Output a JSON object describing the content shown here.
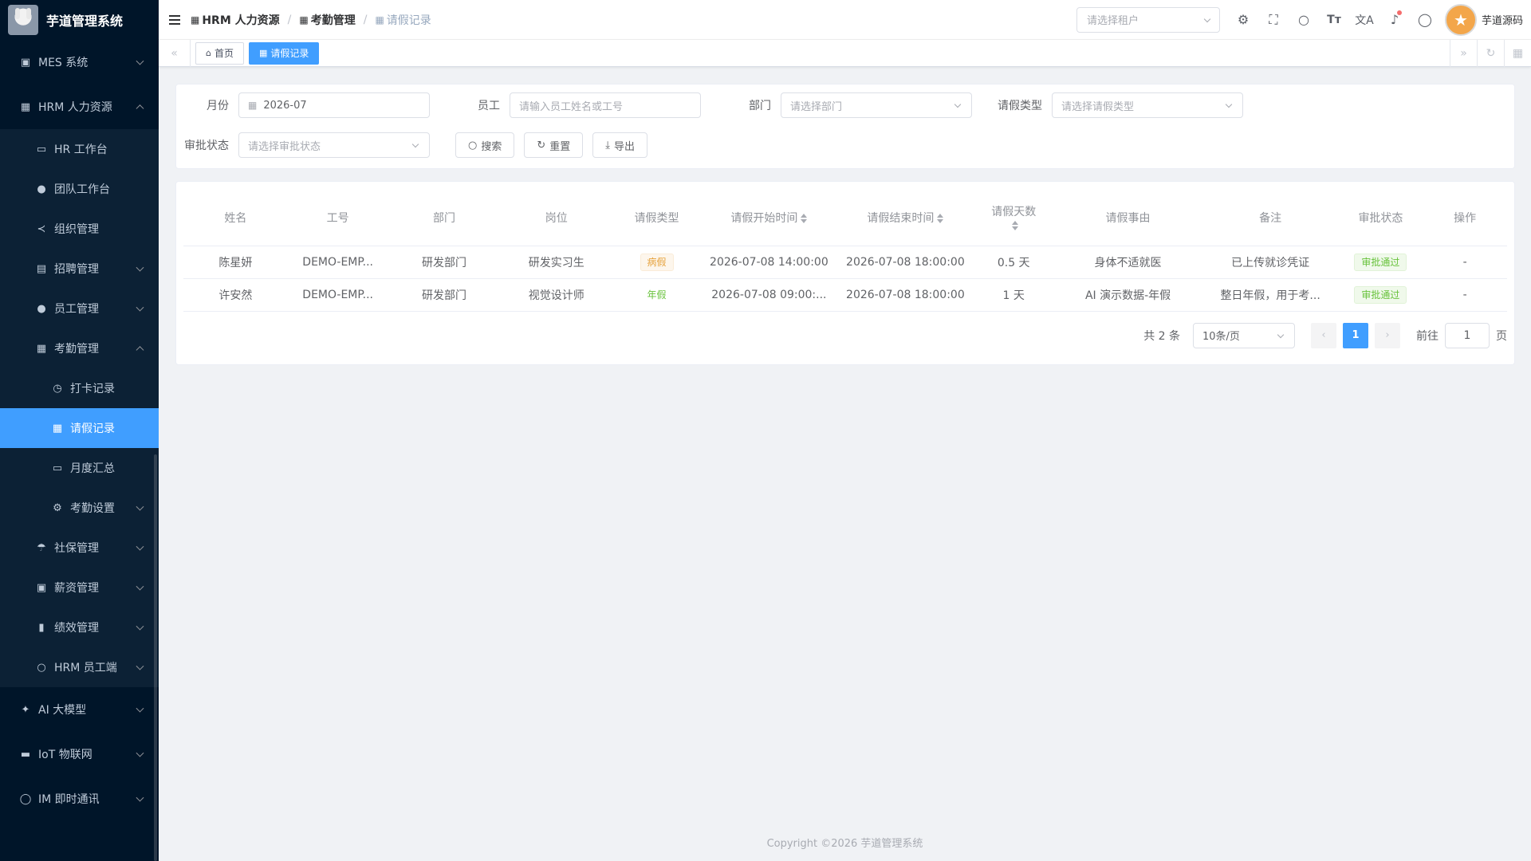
{
  "app": {
    "title": "芋道管理系统"
  },
  "sidebar": {
    "items": [
      {
        "label": "MES 系统",
        "icon": "cpu-icon"
      },
      {
        "label": "HRM 人力资源",
        "icon": "office-building-icon"
      }
    ],
    "hrm_sub": [
      {
        "label": "HR 工作台",
        "icon": "monitor-icon"
      },
      {
        "label": "团队工作台",
        "icon": "user-icon"
      },
      {
        "label": "组织管理",
        "icon": "share-icon"
      },
      {
        "label": "招聘管理",
        "icon": "briefcase-icon"
      },
      {
        "label": "员工管理",
        "icon": "user-icon"
      },
      {
        "label": "考勤管理",
        "icon": "calendar-icon"
      }
    ],
    "attendance_sub": [
      {
        "label": "打卡记录",
        "icon": "stopwatch-icon"
      },
      {
        "label": "请假记录",
        "icon": "calendar-icon"
      },
      {
        "label": "月度汇总",
        "icon": "monitor-icon"
      },
      {
        "label": "考勤设置",
        "icon": "gear-icon"
      }
    ],
    "hrm_sub2": [
      {
        "label": "社保管理",
        "icon": "umbrella-icon"
      },
      {
        "label": "薪资管理",
        "icon": "wallet-icon"
      },
      {
        "label": "绩效管理",
        "icon": "bar-chart-icon"
      },
      {
        "label": "HRM 员工端",
        "icon": "user-icon"
      }
    ],
    "bottom": [
      {
        "label": "AI 大模型",
        "icon": "ai-icon"
      },
      {
        "label": "IoT 物联网",
        "icon": "router-icon"
      },
      {
        "label": "IM 即时通讯",
        "icon": "chat-icon"
      }
    ]
  },
  "breadcrumb": [
    "HRM 人力资源",
    "考勤管理",
    "请假记录"
  ],
  "header": {
    "tenant_placeholder": "请选择租户",
    "username": "芋道源码"
  },
  "tags": {
    "home": "首页",
    "current": "请假记录"
  },
  "search": {
    "month_label": "月份",
    "month_value": "2026-07",
    "employee_label": "员工",
    "employee_placeholder": "请输入员工姓名或工号",
    "dept_label": "部门",
    "dept_placeholder": "请选择部门",
    "leave_type_label": "请假类型",
    "leave_type_placeholder": "请选择请假类型",
    "status_label": "审批状态",
    "status_placeholder": "请选择审批状态",
    "search_btn": "搜索",
    "reset_btn": "重置",
    "export_btn": "导出"
  },
  "table": {
    "headers": [
      "姓名",
      "工号",
      "部门",
      "岗位",
      "请假类型",
      "请假开始时间",
      "请假结束时间",
      "请假天数",
      "请假事由",
      "备注",
      "审批状态",
      "操作"
    ],
    "rows": [
      {
        "name": "陈星妍",
        "code": "DEMO-EMP...",
        "dept": "研发部门",
        "post": "研发实习生",
        "type": "病假",
        "start": "2026-07-08 14:00:00",
        "end": "2026-07-08 18:00:00",
        "days": "0.5 天",
        "reason": "身体不适就医",
        "remark": "已上传就诊凭证",
        "status": "审批通过",
        "op": "-"
      },
      {
        "name": "许安然",
        "code": "DEMO-EMP...",
        "dept": "研发部门",
        "post": "视觉设计师",
        "type": "年假",
        "start": "2026-07-08 09:00:...",
        "end": "2026-07-08 18:00:00",
        "days": "1 天",
        "reason": "AI 演示数据-年假",
        "remark": "整日年假，用于考...",
        "status": "审批通过",
        "op": "-"
      }
    ]
  },
  "pagination": {
    "total": "共 2 条",
    "page_size": "10条/页",
    "current": "1",
    "goto_label": "前往",
    "goto_value": "1",
    "page_suffix": "页"
  },
  "footer": "Copyright ©2026 芋道管理系统",
  "colors": {
    "primary": "#409eff",
    "sidebar_bg": "#001529",
    "success": "#67c23a",
    "warning": "#e6a23c"
  }
}
